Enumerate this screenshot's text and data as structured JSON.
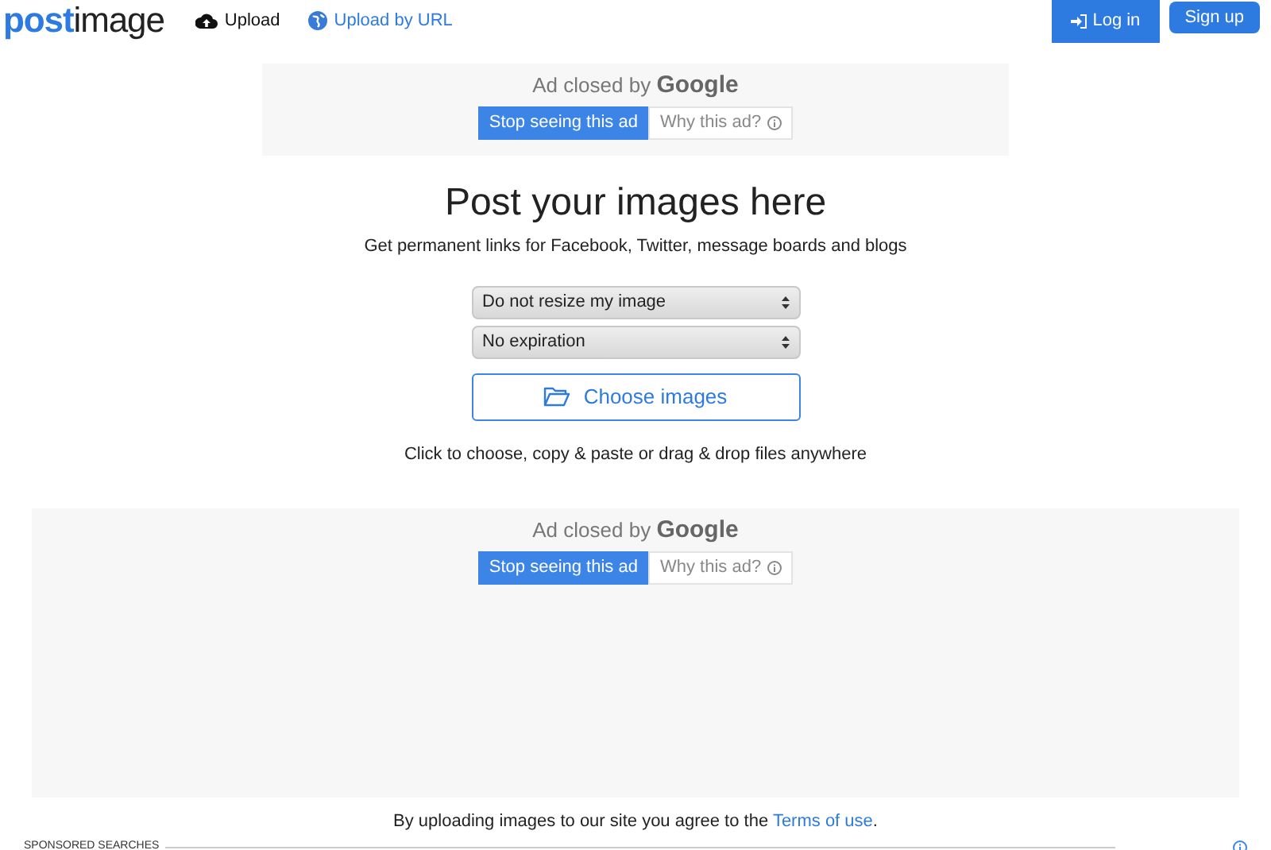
{
  "header": {
    "logo": "postimage",
    "nav": [
      {
        "label": "Upload",
        "kind": "upload"
      },
      {
        "label": "Upload by URL",
        "kind": "url"
      }
    ],
    "buttons": [
      {
        "label": "Log in",
        "kind": "login"
      },
      {
        "label": "Sign up",
        "kind": "signup"
      }
    ]
  },
  "ads": [
    {
      "closed_text": "Ad closed by",
      "brand": "Google",
      "stop_button": "Stop seeing this ad",
      "why_button": "Why this ad?",
      "kind": "banner"
    },
    {
      "closed_text": "Ad closed by",
      "brand": "Google",
      "stop_button": "Stop seeing this ad",
      "why_button": "Why this ad?",
      "kind": "block"
    }
  ],
  "main": {
    "title": "Post your images here",
    "subtitle": "Get permanent links for Facebook, Twitter, message boards and blogs",
    "selects": [
      {
        "value": "Do not resize my image"
      },
      {
        "value": "No expiration"
      }
    ],
    "choose_button": "Choose images",
    "hint": "Click to choose, copy & paste or drag & drop files anywhere"
  },
  "terms": {
    "before": "By uploading images to our site you agree to the",
    "link": "Terms of use",
    "after": "."
  },
  "sponsored": {
    "label": "SPONSORED SEARCHES"
  }
}
